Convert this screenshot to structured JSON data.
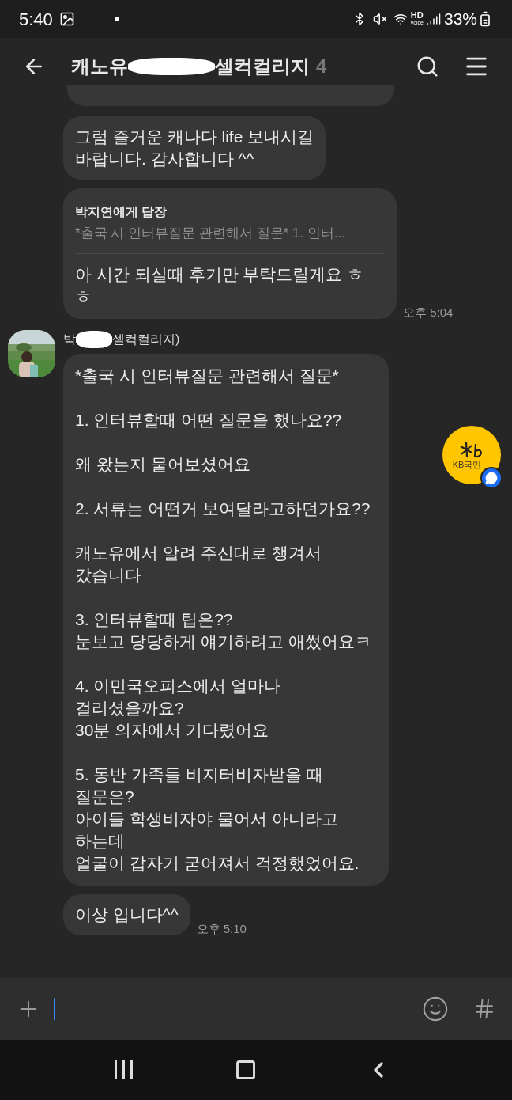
{
  "status_bar": {
    "time": "5:40",
    "hd_label": "HD",
    "voice_label": "voice",
    "battery": "33%"
  },
  "header": {
    "title_start": "캐노유",
    "title_end": "셀컥컬리지",
    "member_count": "4"
  },
  "messages": [
    {
      "kind": "plain",
      "text": "그럼 즐거운 캐나다 life 보내시길\n바랍니다. 감사합니다 ^^"
    },
    {
      "kind": "reply",
      "reply_to": "박지연에게 답장",
      "quote": "*출국 시 인터뷰질문 관련해서 질문*  1. 인터...",
      "text": "아 시간 되실때 후기만 부탁드릴게요 ㅎㅎ",
      "time": "오후 5:04"
    },
    {
      "kind": "incoming",
      "sender_start": "박",
      "sender_end": "셀컥컬리지)",
      "text": "*출국 시 인터뷰질문 관련해서 질문*\n\n1. 인터뷰할때 어떤 질문을 했나요??\n\n왜 왔는지 물어보셨어요\n\n2. 서류는 어떤거 보여달라고하던가요??\n\n캐노유에서 알려 주신대로 챙겨서\n갔습니다\n\n3. 인터뷰할때 팁은??\n눈보고 당당하게 얘기하려고 애썼어요ㅋ\n\n4. 이민국오피스에서 얼마나\n걸리셨을까요?\n30분 의자에서 기다렸어요\n\n5. 동반 가족들 비지터비자받을 때\n질문은?\n아이들 학생비자야 물어서 아니라고\n하는데\n얼굴이 갑자기 굳어져서 걱정했었어요."
    },
    {
      "kind": "plain",
      "text": "이상 입니다^^",
      "time": "오후 5:10"
    }
  ],
  "floating_button": {
    "label": "KB국민"
  }
}
